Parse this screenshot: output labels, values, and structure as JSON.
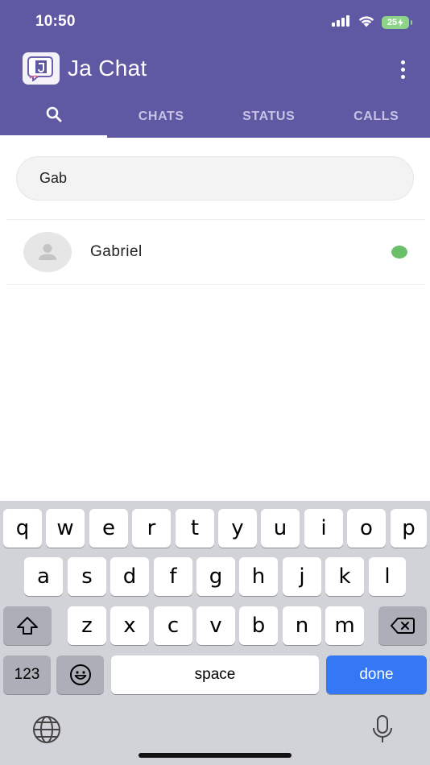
{
  "status_bar": {
    "time": "10:50",
    "battery": "25"
  },
  "app": {
    "title": "Ja Chat"
  },
  "tabs": [
    {
      "label": "",
      "icon": "search-icon",
      "active": true
    },
    {
      "label": "CHATS",
      "active": false
    },
    {
      "label": "STATUS",
      "active": false
    },
    {
      "label": "CALLS",
      "active": false
    }
  ],
  "search": {
    "value": "Gab"
  },
  "contacts": [
    {
      "name": "Gabriel",
      "online": true
    }
  ],
  "keyboard": {
    "row1": [
      "q",
      "w",
      "e",
      "r",
      "t",
      "y",
      "u",
      "i",
      "o",
      "p"
    ],
    "row2": [
      "a",
      "s",
      "d",
      "f",
      "g",
      "h",
      "j",
      "k",
      "l"
    ],
    "row3": [
      "z",
      "x",
      "c",
      "v",
      "b",
      "n",
      "m"
    ],
    "numbers_label": "123",
    "space_label": "space",
    "done_label": "done"
  },
  "colors": {
    "header": "#5f58a3",
    "online": "#6abf69",
    "done_key": "#3478f6",
    "battery": "#8ed38a"
  }
}
